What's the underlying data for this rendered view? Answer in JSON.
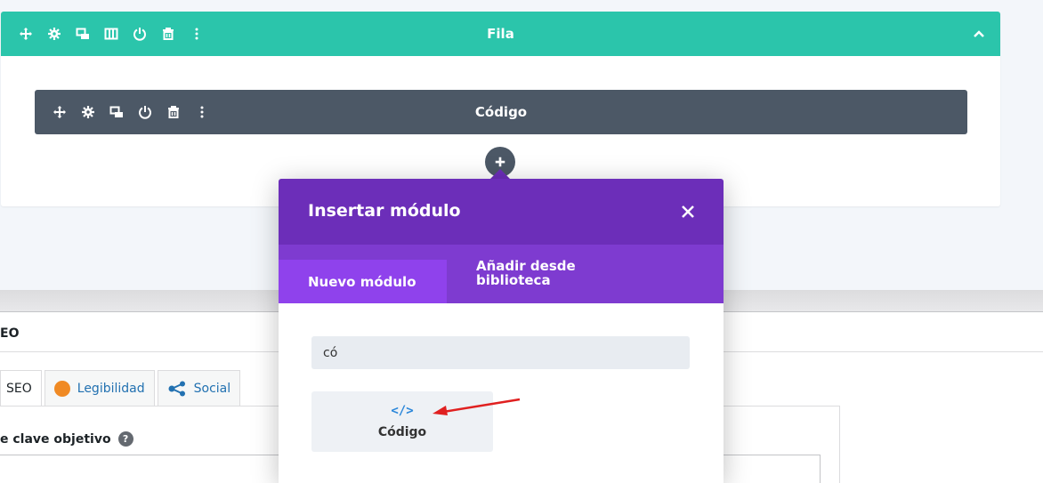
{
  "row": {
    "title": "Fila"
  },
  "module": {
    "title": "Código"
  },
  "modal": {
    "title": "Insertar módulo",
    "tab_new": "Nuevo módulo",
    "tab_library": "Añadir desde biblioteca",
    "search_value": "có",
    "results": [
      {
        "label": "Código",
        "icon": "code-icon",
        "icon_glyph": "</>"
      }
    ]
  },
  "seo": {
    "heading": "EO",
    "tabs": [
      {
        "label": "SEO"
      },
      {
        "label": "Legibilidad"
      },
      {
        "label": "Social"
      }
    ],
    "keyword_label": "e clave objetivo",
    "help_glyph": "?"
  },
  "colors": {
    "row_bar": "#2bc5ab",
    "module_bar": "#4c5866",
    "modal_header": "#6c2eb9",
    "modal_tabs": "#7e3bd0",
    "active_tab": "#8f42ec",
    "code_icon": "#2b87da",
    "readability_dot": "#f08a24",
    "arrow": "#e02020"
  }
}
